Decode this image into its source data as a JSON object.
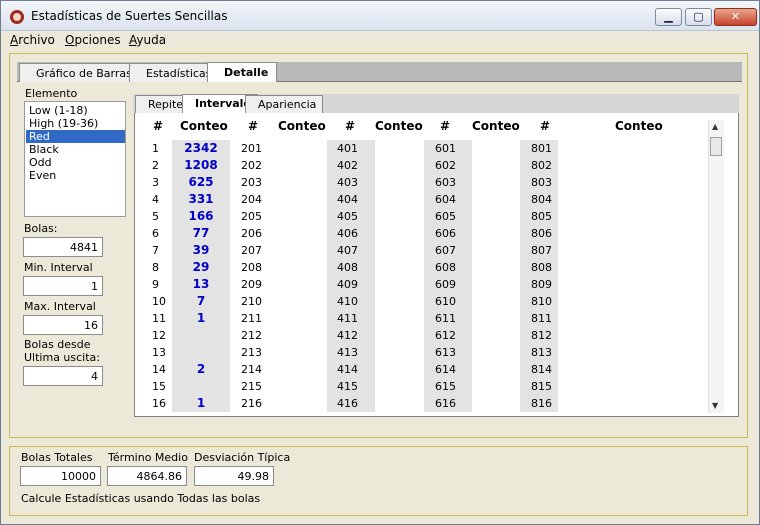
{
  "window": {
    "title": "Estadísticas de Suertes Sencillas",
    "minimize": "▁",
    "maximize": "▢",
    "close": "✕"
  },
  "menu": [
    {
      "first": "A",
      "rest": "rchivo"
    },
    {
      "first": "O",
      "rest": "pciones"
    },
    {
      "first": "A",
      "rest": "yuda"
    }
  ],
  "tabs": [
    "Gráfico de Barras",
    "Estadísticas",
    "Detalle"
  ],
  "elemento": {
    "label": "Elemento",
    "items": [
      "Low (1-18)",
      "High (19-36)",
      "Red",
      "Black",
      "Odd",
      "Even"
    ],
    "selected": "Red"
  },
  "fields": {
    "bolas": {
      "label": "Bolas:",
      "value": "4841"
    },
    "min_interval": {
      "label": "Min. Interval",
      "value": "1"
    },
    "max_interval": {
      "label": "Max. Interval",
      "value": "16"
    },
    "desde": {
      "label1": "Bolas desde",
      "label2": "Ultima uscita:",
      "value": "4"
    }
  },
  "subtabs": [
    "Repite",
    "Intervalo",
    "Apariencia"
  ],
  "grid": {
    "headers": [
      "#",
      "Conteo",
      "#",
      "Conteo",
      "#",
      "Conteo",
      "#",
      "Conteo",
      "#",
      "Conteo"
    ],
    "col1": [
      "1",
      "2",
      "3",
      "4",
      "5",
      "6",
      "7",
      "8",
      "9",
      "10",
      "11",
      "12",
      "13",
      "14",
      "15",
      "16"
    ],
    "conteo1": [
      "2342",
      "1208",
      "625",
      "331",
      "166",
      "77",
      "39",
      "29",
      "13",
      "7",
      "1",
      "",
      "",
      "2",
      "",
      "1"
    ],
    "col2": [
      "201",
      "202",
      "203",
      "204",
      "205",
      "206",
      "207",
      "208",
      "209",
      "210",
      "211",
      "212",
      "213",
      "214",
      "215",
      "216"
    ],
    "col3": [
      "401",
      "402",
      "403",
      "404",
      "405",
      "406",
      "407",
      "408",
      "409",
      "410",
      "411",
      "412",
      "413",
      "414",
      "415",
      "416"
    ],
    "col4": [
      "601",
      "602",
      "603",
      "604",
      "605",
      "606",
      "607",
      "608",
      "609",
      "610",
      "611",
      "612",
      "613",
      "614",
      "615",
      "616"
    ],
    "col5": [
      "801",
      "802",
      "803",
      "804",
      "805",
      "806",
      "807",
      "808",
      "809",
      "810",
      "811",
      "812",
      "813",
      "814",
      "815",
      "816"
    ]
  },
  "summary": {
    "totales": {
      "label": "Bolas Totales",
      "value": "10000"
    },
    "medio": {
      "label": "Término Medio",
      "value": "4864.86"
    },
    "desviacion": {
      "label": "Desviación Típica",
      "value": "49.98"
    },
    "note": "Calcule Estadísticas usando Todas las bolas"
  }
}
